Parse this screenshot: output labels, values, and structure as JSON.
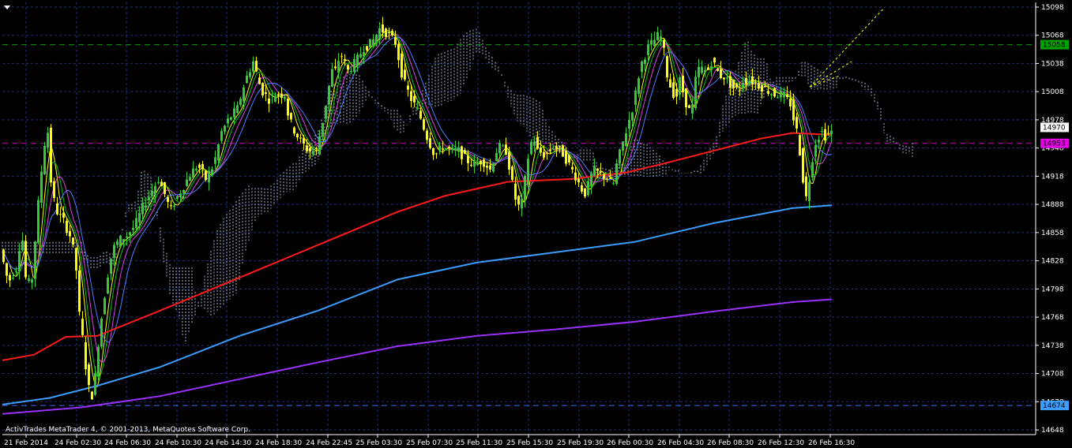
{
  "window": {
    "credit": "ActivTrades MetaTrader 4, © 2001-2013, MetaQuotes Software Corp.",
    "menu_glyph": "triangle-down-icon"
  },
  "colors": {
    "background": "#000000",
    "grid": "#1c2f88",
    "bull_candle": "#32cd32",
    "bear_candle": "#ffff00",
    "ma_fast": "#ffff00",
    "ma_green": "#00c000",
    "ma_magenta": "#e040e0",
    "ma_blue": "#4f7cff",
    "ma_red": "#ff1a1a",
    "ma_azure": "#3a9dff",
    "ma_purple": "#9b30ff",
    "cloud": "#c8d8ff",
    "line_green": "#00a000",
    "line_magenta": "#d000d0",
    "line_blue": "#3b6dff"
  },
  "chart_data": {
    "type": "candlestick",
    "symbol_timeframe_visible": false,
    "grid": true,
    "y_ticks": [
      15098,
      15068,
      15038,
      15008,
      14978,
      14948,
      14918,
      14888,
      14858,
      14828,
      14798,
      14768,
      14738,
      14708,
      14678,
      14648
    ],
    "x_ticks": [
      "21 Feb 2014",
      "24 Feb 02:30",
      "24 Feb 06:30",
      "24 Feb 10:30",
      "24 Feb 14:30",
      "24 Feb 18:30",
      "24 Feb 22:45",
      "25 Feb 03:30",
      "25 Feb 07:30",
      "25 Feb 11:30",
      "25 Feb 15:30",
      "25 Feb 19:30",
      "26 Feb 00:30",
      "26 Feb 04:30",
      "26 Feb 08:30",
      "26 Feb 12:30",
      "26 Feb 16:30"
    ],
    "ylim": [
      14643,
      15103
    ],
    "price_tags": [
      {
        "value": 15058,
        "label": "15058",
        "color": "#00a000"
      },
      {
        "value": 14970,
        "label": "14970",
        "color": "#ffffff"
      },
      {
        "value": 14953,
        "label": "14953",
        "color": "#e000e0"
      },
      {
        "value": 14674,
        "label": "14674",
        "color": "#3a9dff"
      }
    ],
    "horizontal_lines": [
      {
        "value": 15058,
        "color": "#00a000",
        "style": "dashed"
      },
      {
        "value": 14953,
        "color": "#d000d0",
        "style": "dashed"
      },
      {
        "value": 14674,
        "color": "#3b6dff",
        "style": "dashed"
      }
    ],
    "price_path": [
      [
        0,
        14840
      ],
      [
        10,
        14805
      ],
      [
        20,
        14820
      ],
      [
        27,
        14860
      ],
      [
        33,
        14800
      ],
      [
        40,
        14810
      ],
      [
        47,
        14880
      ],
      [
        55,
        14950
      ],
      [
        60,
        14965
      ],
      [
        65,
        14900
      ],
      [
        72,
        14880
      ],
      [
        80,
        14870
      ],
      [
        88,
        14855
      ],
      [
        95,
        14830
      ],
      [
        100,
        14770
      ],
      [
        105,
        14740
      ],
      [
        110,
        14700
      ],
      [
        115,
        14680
      ],
      [
        120,
        14705
      ],
      [
        125,
        14750
      ],
      [
        130,
        14780
      ],
      [
        135,
        14810
      ],
      [
        142,
        14840
      ],
      [
        150,
        14850
      ],
      [
        160,
        14855
      ],
      [
        170,
        14865
      ],
      [
        180,
        14885
      ],
      [
        190,
        14900
      ],
      [
        200,
        14915
      ],
      [
        210,
        14895
      ],
      [
        215,
        14880
      ],
      [
        220,
        14890
      ],
      [
        230,
        14905
      ],
      [
        240,
        14920
      ],
      [
        250,
        14930
      ],
      [
        260,
        14915
      ],
      [
        270,
        14930
      ],
      [
        280,
        14965
      ],
      [
        290,
        14980
      ],
      [
        300,
        14990
      ],
      [
        310,
        15020
      ],
      [
        320,
        15040
      ],
      [
        330,
        15010
      ],
      [
        340,
        15000
      ],
      [
        350,
        15005
      ],
      [
        360,
        15005
      ],
      [
        365,
        14980
      ],
      [
        370,
        14970
      ],
      [
        380,
        14955
      ],
      [
        390,
        14945
      ],
      [
        400,
        14945
      ],
      [
        405,
        14965
      ],
      [
        410,
        14985
      ],
      [
        415,
        15010
      ],
      [
        420,
        15030
      ],
      [
        425,
        15030
      ],
      [
        430,
        15050
      ],
      [
        440,
        15030
      ],
      [
        450,
        15040
      ],
      [
        460,
        15055
      ],
      [
        470,
        15060
      ],
      [
        480,
        15075
      ],
      [
        490,
        15070
      ],
      [
        500,
        15060
      ],
      [
        505,
        15040
      ],
      [
        510,
        15020
      ],
      [
        520,
        15000
      ],
      [
        530,
        14985
      ],
      [
        540,
        14960
      ],
      [
        550,
        14940
      ],
      [
        560,
        14950
      ],
      [
        570,
        14945
      ],
      [
        580,
        14945
      ],
      [
        590,
        14935
      ],
      [
        600,
        14930
      ],
      [
        610,
        14935
      ],
      [
        620,
        14925
      ],
      [
        630,
        14950
      ],
      [
        640,
        14945
      ],
      [
        645,
        14925
      ],
      [
        650,
        14900
      ],
      [
        655,
        14885
      ],
      [
        660,
        14890
      ],
      [
        665,
        14920
      ],
      [
        670,
        14950
      ],
      [
        675,
        14960
      ],
      [
        680,
        14945
      ],
      [
        690,
        14940
      ],
      [
        700,
        14950
      ],
      [
        710,
        14945
      ],
      [
        720,
        14930
      ],
      [
        730,
        14915
      ],
      [
        735,
        14905
      ],
      [
        740,
        14900
      ],
      [
        745,
        14910
      ],
      [
        750,
        14925
      ],
      [
        760,
        14920
      ],
      [
        770,
        14915
      ],
      [
        775,
        14905
      ],
      [
        780,
        14930
      ],
      [
        790,
        14960
      ],
      [
        800,
        14990
      ],
      [
        805,
        15010
      ],
      [
        810,
        15035
      ],
      [
        815,
        15045
      ],
      [
        820,
        15055
      ],
      [
        825,
        15060
      ],
      [
        830,
        15065
      ],
      [
        835,
        15070
      ],
      [
        840,
        15050
      ],
      [
        845,
        15020
      ],
      [
        850,
        15010
      ],
      [
        855,
        15000
      ],
      [
        860,
        15020
      ],
      [
        865,
        15005
      ],
      [
        870,
        14990
      ],
      [
        875,
        14985
      ],
      [
        880,
        15020
      ],
      [
        885,
        15035
      ],
      [
        890,
        15030
      ],
      [
        895,
        15030
      ],
      [
        900,
        15040
      ],
      [
        905,
        15035
      ],
      [
        910,
        15025
      ],
      [
        915,
        15025
      ],
      [
        920,
        15020
      ],
      [
        925,
        15015
      ],
      [
        930,
        15010
      ],
      [
        935,
        15010
      ],
      [
        940,
        15020
      ],
      [
        950,
        15020
      ],
      [
        960,
        15015
      ],
      [
        970,
        15010
      ],
      [
        980,
        15005
      ],
      [
        990,
        15005
      ],
      [
        995,
        15000
      ],
      [
        1000,
        14995
      ],
      [
        1005,
        14975
      ],
      [
        1010,
        14960
      ],
      [
        1015,
        14920
      ],
      [
        1020,
        14895
      ],
      [
        1025,
        14920
      ],
      [
        1030,
        14950
      ],
      [
        1035,
        14960
      ],
      [
        1040,
        14965
      ],
      [
        1045,
        14960
      ],
      [
        1050,
        14965
      ]
    ]
  }
}
